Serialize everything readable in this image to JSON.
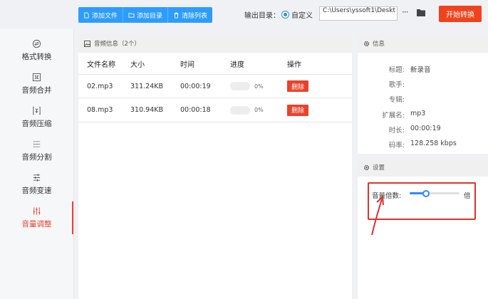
{
  "toolbar": {
    "add_file": "添加文件",
    "add_dir": "添加目录",
    "clear_list": "清除列表",
    "output_label": "输出目录：",
    "custom_option": "自定义",
    "output_path": "C:\\Users\\yssoft1\\Deskt",
    "more": "···",
    "start": "开始转换"
  },
  "sidebar": {
    "items": [
      {
        "label": "格式转换",
        "icon": "format-convert-icon"
      },
      {
        "label": "音频合并",
        "icon": "audio-merge-icon"
      },
      {
        "label": "音频压缩",
        "icon": "audio-compress-icon"
      },
      {
        "label": "音频分割",
        "icon": "audio-split-icon"
      },
      {
        "label": "音频变速",
        "icon": "audio-speed-icon"
      },
      {
        "label": "音量调整",
        "icon": "volume-adjust-icon",
        "active": true
      }
    ]
  },
  "main": {
    "title": "音频信息（2个）",
    "columns": [
      "文件名称",
      "大小",
      "时间",
      "进度",
      "操作"
    ],
    "rows": [
      {
        "name": "02.mp3",
        "size": "311.24KB",
        "time": "00:00:19",
        "progress": "0%",
        "action": "删除"
      },
      {
        "name": "08.mp3",
        "size": "310.94KB",
        "time": "00:00:18",
        "progress": "0%",
        "action": "删除"
      }
    ]
  },
  "info": {
    "title": "信息",
    "fields": [
      {
        "key": "标题:",
        "value": "新录音"
      },
      {
        "key": "歌手:",
        "value": ""
      },
      {
        "key": "专辑:",
        "value": ""
      },
      {
        "key": "扩展名:",
        "value": "mp3"
      },
      {
        "key": "时长:",
        "value": "00:00:19"
      },
      {
        "key": "码率:",
        "value": "128.258 kbps"
      }
    ]
  },
  "settings": {
    "title": "设置",
    "volume_label": "音量倍数:",
    "volume_unit": "倍",
    "volume_fraction": 0.33
  },
  "colors": {
    "accent_blue": "#2d9cff",
    "start_red": "#f0431d",
    "active_red": "#e8432a",
    "annotation_red": "#e0312b"
  }
}
